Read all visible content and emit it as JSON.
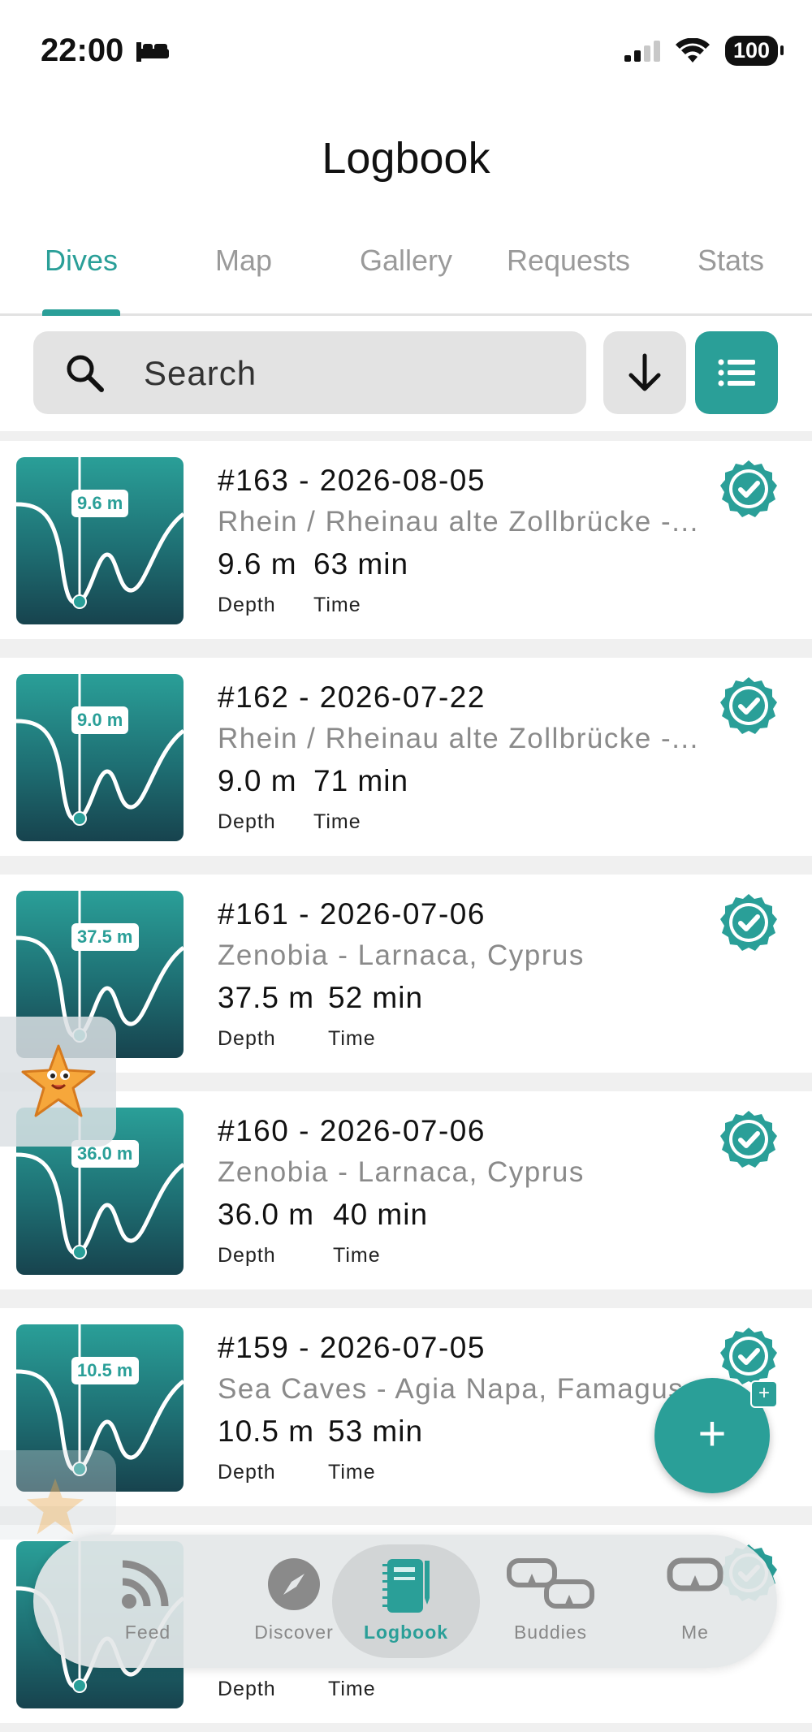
{
  "status": {
    "time": "22:00",
    "battery": "100"
  },
  "header": {
    "title": "Logbook"
  },
  "tabs": [
    "Dives",
    "Map",
    "Gallery",
    "Requests",
    "Stats"
  ],
  "search": {
    "placeholder": "Search"
  },
  "colors": {
    "accent": "#2a9f98",
    "muted": "#8a8a8a"
  },
  "labels": {
    "depth": "Depth",
    "time": "Time"
  },
  "dives": [
    {
      "title": "#163 - 2026-08-05",
      "site": "Rhein / Rheinau alte Zollbrücke -...",
      "depth": "9.6 m",
      "time": "63 min",
      "tag": "9.6 m"
    },
    {
      "title": "#162 - 2026-07-22",
      "site": "Rhein / Rheinau alte Zollbrücke -...",
      "depth": "9.0 m",
      "time": "71 min",
      "tag": "9.0 m"
    },
    {
      "title": "#161 - 2026-07-06",
      "site": "Zenobia - Larnaca, Cyprus",
      "depth": "37.5 m",
      "time": "52 min",
      "tag": "37.5 m"
    },
    {
      "title": "#160 - 2026-07-06",
      "site": "Zenobia - Larnaca, Cyprus",
      "depth": "36.0 m",
      "time": "40 min",
      "tag": "36.0 m"
    },
    {
      "title": "#159 - 2026-07-05",
      "site": "Sea Caves - Agia Napa, Famagus",
      "depth": "10.5 m",
      "time": "53 min",
      "tag": "10.5 m"
    },
    {
      "title": "",
      "site": "",
      "depth": "",
      "time": "",
      "tag": ""
    }
  ],
  "fab": {
    "label": "+"
  },
  "nav": [
    {
      "label": "Feed",
      "icon": "rss-icon"
    },
    {
      "label": "Discover",
      "icon": "compass-icon"
    },
    {
      "label": "Logbook",
      "icon": "notebook-icon"
    },
    {
      "label": "Buddies",
      "icon": "dive-masks-icon"
    },
    {
      "label": "Me",
      "icon": "dive-mask-icon"
    }
  ]
}
